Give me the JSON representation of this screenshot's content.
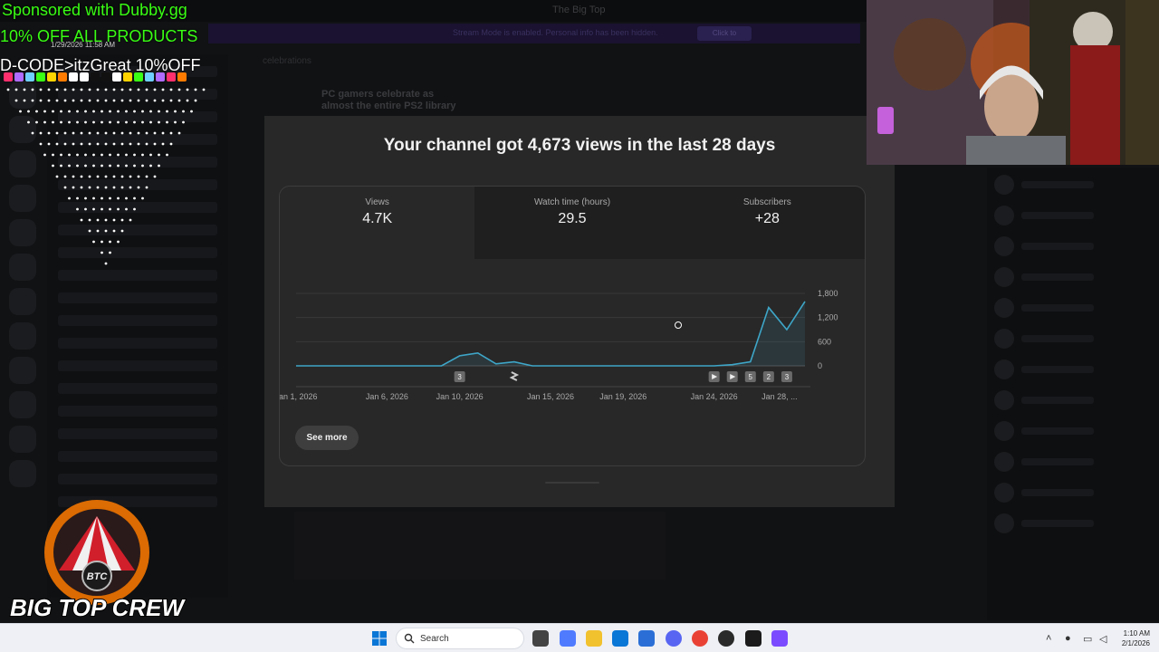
{
  "background": {
    "window_title": "The Big Top",
    "banner_text": "Stream Mode is enabled. Personal info has been hidden.",
    "banner_button": "Click to",
    "post_title_line1": "PC gamers celebrate as",
    "post_title_line2": "almost the entire PS2 library",
    "tags_text": "celebrations"
  },
  "modal": {
    "title": "Your channel got 4,673 views in the last 28 days",
    "tabs": [
      {
        "label": "Views",
        "value": "4.7K"
      },
      {
        "label": "Watch time (hours)",
        "value": "29.5"
      },
      {
        "label": "Subscribers",
        "value": "+28"
      }
    ],
    "see_more_label": "See more"
  },
  "chart_data": {
    "type": "area",
    "title": "",
    "xlabel": "",
    "ylabel": "",
    "x_tick_labels": [
      "Jan 1, 2026",
      "Jan 6, 2026",
      "Jan 10, 2026",
      "Jan 15, 2026",
      "Jan 19, 2026",
      "Jan 24, 2026",
      "Jan 28, ..."
    ],
    "y_tick_labels": [
      "1,800",
      "1,200",
      "600",
      "0"
    ],
    "y_ticks": [
      1800,
      1200,
      600,
      0
    ],
    "ylim": [
      0,
      1800
    ],
    "series": [
      {
        "values": [
          0,
          0,
          0,
          0,
          0,
          0,
          0,
          0,
          0,
          250,
          320,
          50,
          100,
          0,
          0,
          0,
          0,
          0,
          0,
          0,
          0,
          0,
          0,
          0,
          30,
          100,
          1450,
          900,
          1600
        ]
      }
    ],
    "markers": [
      {
        "day_index": 9,
        "label": "3",
        "kind": "badge"
      },
      {
        "day_index": 12,
        "label": "",
        "kind": "shorts"
      },
      {
        "day_index": 23,
        "label": "",
        "kind": "play"
      },
      {
        "day_index": 24,
        "label": "",
        "kind": "play"
      },
      {
        "day_index": 25,
        "label": "5",
        "kind": "badge"
      },
      {
        "day_index": 26,
        "label": "2",
        "kind": "badge"
      },
      {
        "day_index": 27,
        "label": "3",
        "kind": "badge"
      }
    ],
    "line_color": "#3ea6c8",
    "grid": true
  },
  "overlay": {
    "sponsor": "Sponsored with Dubby.gg",
    "offer": "10% OFF ALL PRODUCTS",
    "code": "D-CODE>itzGreat 10%OFF",
    "datetime": "1/29/2026 11:58 AM",
    "logo_initials": "BTC",
    "logo_text": "BIG TOP CREW"
  },
  "taskbar": {
    "search_placeholder": "Search",
    "time": "1:10 AM",
    "date": "2/1/2026"
  },
  "colors": {
    "accent_green": "#39ff14",
    "chart_line": "#3ea6c8",
    "modal_bg": "#282828"
  }
}
